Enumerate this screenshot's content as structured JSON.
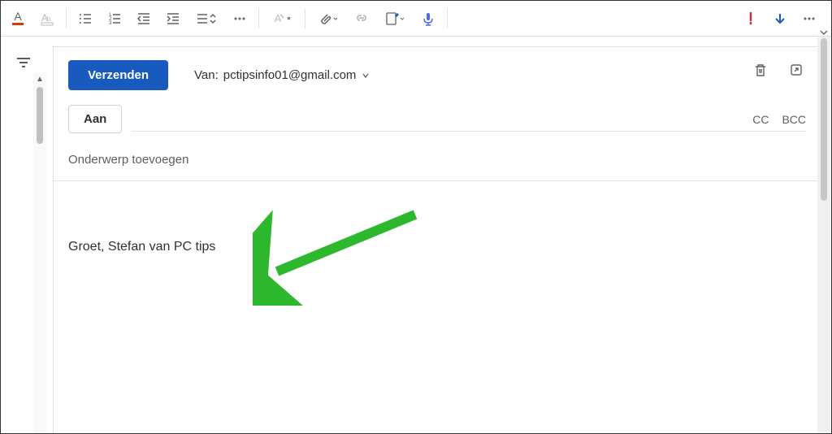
{
  "compose": {
    "send_label": "Verzenden",
    "from_label": "Van:",
    "from_email": "pctipsinfo01@gmail.com",
    "to_label": "Aan",
    "cc_label": "CC",
    "bcc_label": "BCC",
    "subject_placeholder": "Onderwerp toevoegen",
    "body_signature": "Groet, Stefan van PC tips"
  },
  "colors": {
    "primary": "#185abd",
    "arrow": "#2db82d"
  }
}
